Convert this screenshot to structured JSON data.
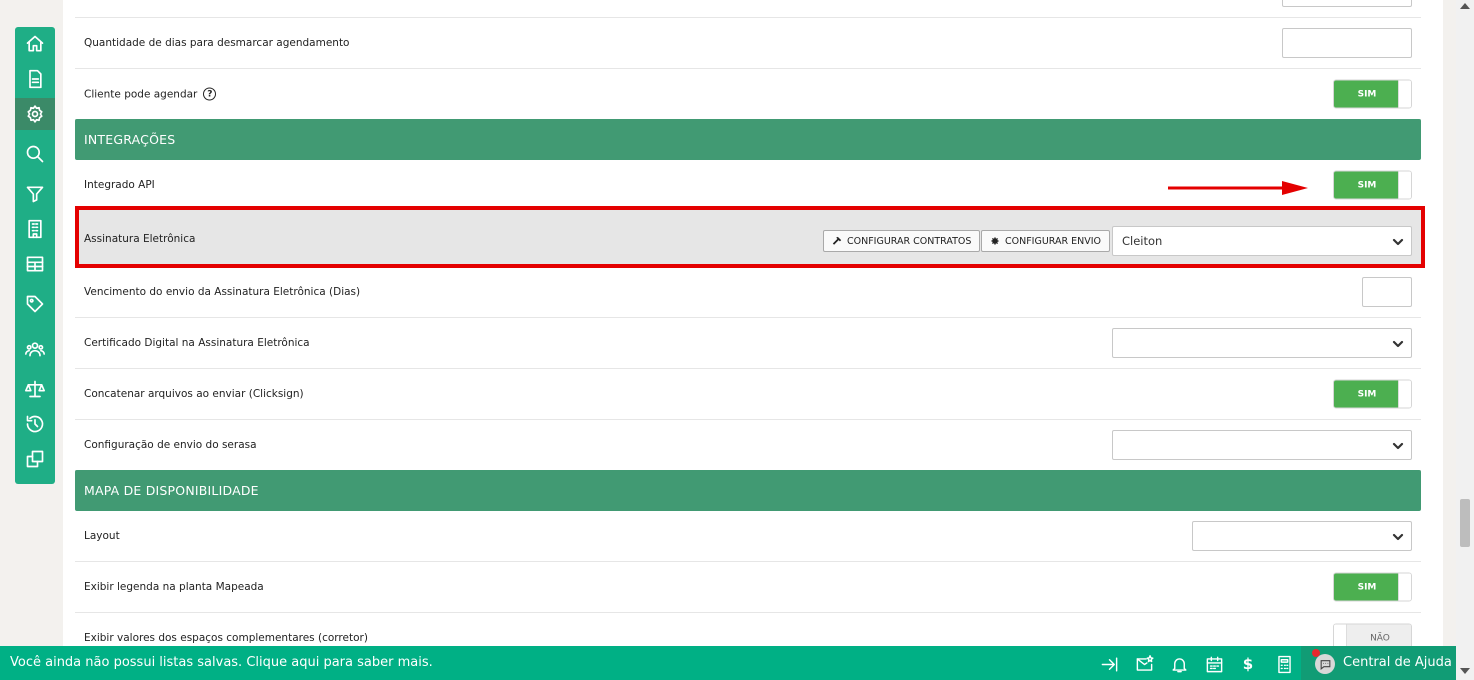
{
  "rows": {
    "quantidade_dias": "Quantidade de dias para desmarcar agendamento",
    "cliente_pode_agendar": "Cliente pode agendar",
    "integrado_api": "Integrado API",
    "assinatura_eletronica": "Assinatura Eletrônica",
    "vencimento": "Vencimento do envio da Assinatura Eletrônica (Dias)",
    "certificado": "Certificado Digital na Assinatura Eletrônica",
    "concatenar": "Concatenar arquivos ao enviar (Clicksign)",
    "serasa": "Configuração de envio do serasa",
    "layout": "Layout",
    "legenda": "Exibir legenda na planta Mapeada",
    "valores": "Exibir valores dos espaços complementares (corretor)"
  },
  "sections": {
    "integracoes": "INTEGRAÇÕES",
    "mapa": "MAPA DE DISPONIBILIDADE"
  },
  "toggles": {
    "sim": "SIM",
    "nao": "NÃO"
  },
  "buttons": {
    "configurar_contratos": "CONFIGURAR CONTRATOS",
    "configurar_envio": "CONFIGURAR ENVIO"
  },
  "selects": {
    "assinatura_value": "Cleiton"
  },
  "bottombar": {
    "message": "Você ainda não possui listas salvas. Clique aqui para saber mais.",
    "dollar": "$",
    "help_label": "Central de Ajuda"
  },
  "colors": {
    "sidebar": "#1fae86",
    "section_header": "#419a73",
    "toggle_on": "#4caf50",
    "highlight_border": "#e40000",
    "bottombar": "#00b085"
  },
  "icons": {
    "sidebar": [
      "home-icon",
      "document-icon",
      "gear-icon",
      "search-icon",
      "filter-icon",
      "building-icon",
      "table-icon",
      "tag-icon",
      "users-icon",
      "scale-icon",
      "history-icon",
      "copy-icon"
    ],
    "bottombar": [
      "collapse-arrow-icon",
      "mail-star-icon",
      "bell-icon",
      "calendar-icon",
      "dollar-icon",
      "calculator-icon",
      "chat-icon"
    ]
  }
}
